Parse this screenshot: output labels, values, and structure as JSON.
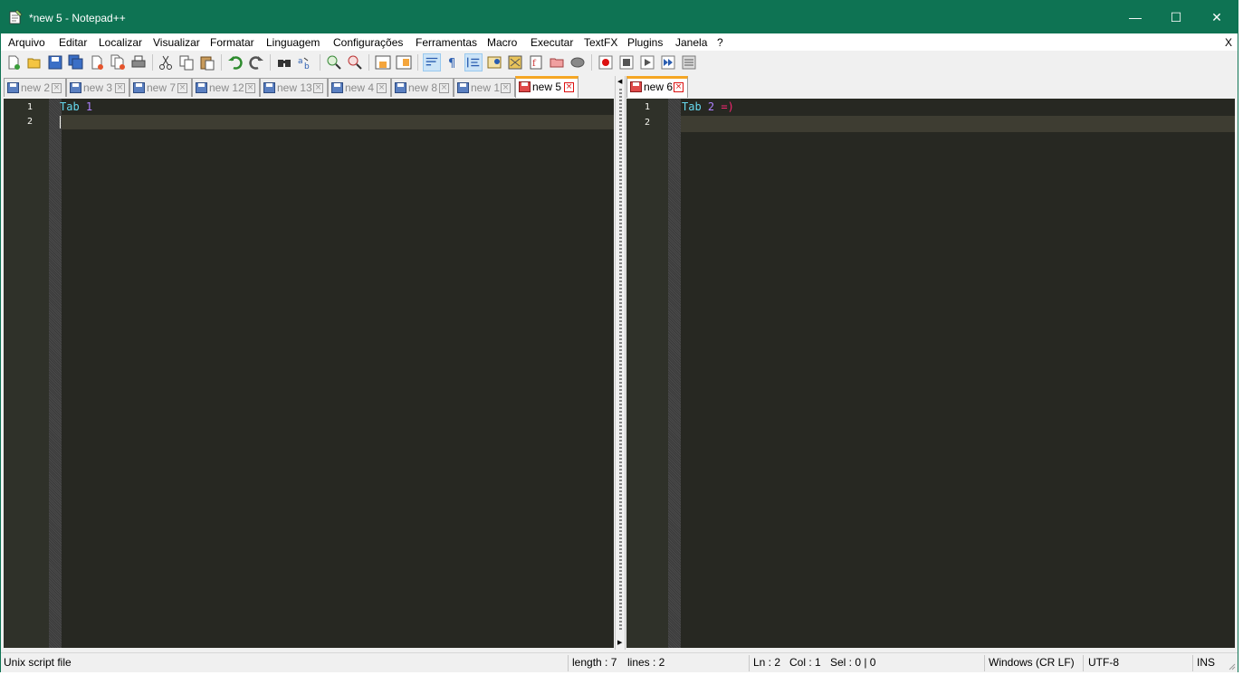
{
  "window": {
    "title": "*new 5 - Notepad++",
    "minimize_glyph": "—",
    "maximize_glyph": "☐",
    "close_glyph": "✕",
    "accent": "#0e7353"
  },
  "menu": {
    "items": [
      "Arquivo",
      "Editar",
      "Localizar",
      "Visualizar",
      "Formatar",
      "Linguagem",
      "Configurações",
      "Ferramentas",
      "Macro",
      "Executar",
      "TextFX",
      "Plugins",
      "Janela",
      "?"
    ],
    "close_doc": "X"
  },
  "toolbar": {
    "icons": [
      "new-file-icon",
      "open-file-icon",
      "save-icon",
      "save-all-icon",
      "close-icon",
      "close-all-icon",
      "print-icon",
      "cut-icon",
      "copy-icon",
      "paste-icon",
      "undo-icon",
      "redo-icon",
      "find-icon",
      "replace-icon",
      "zoom-in-icon",
      "zoom-out-icon",
      "sync-vertical-icon",
      "sync-horizontal-icon",
      "word-wrap-icon",
      "show-all-chars-icon",
      "indent-guide-icon",
      "user-language-icon",
      "document-map-icon",
      "function-list-icon",
      "folder-as-workspace-icon",
      "monitoring-icon",
      "record-macro-icon",
      "stop-macro-icon",
      "play-macro-icon",
      "run-macro-multiple-icon",
      "save-macro-icon"
    ]
  },
  "left_view": {
    "tabs": [
      {
        "label": "new 2",
        "active": false
      },
      {
        "label": "new 3",
        "active": false
      },
      {
        "label": "new 7",
        "active": false
      },
      {
        "label": "new 12",
        "active": false
      },
      {
        "label": "new 13",
        "active": false
      },
      {
        "label": "new 4",
        "active": false
      },
      {
        "label": "new 8",
        "active": false
      },
      {
        "label": "new 1",
        "active": false
      },
      {
        "label": "new 5",
        "active": true
      }
    ],
    "lines": [
      "1",
      "2"
    ],
    "code": {
      "kw": "Tab",
      "num": "1"
    }
  },
  "right_view": {
    "tabs": [
      {
        "label": "new 6",
        "active": true
      }
    ],
    "lines": [
      "1",
      "2"
    ],
    "code": {
      "kw": "Tab",
      "num": "2",
      "op": "=)"
    }
  },
  "status": {
    "file_type": "Unix script file",
    "length": "length : 7",
    "lines": "lines : 2",
    "ln": "Ln : 2",
    "col": "Col : 1",
    "sel": "Sel : 0 | 0",
    "eol": "Windows (CR LF)",
    "encoding": "UTF-8",
    "mode": "INS"
  }
}
